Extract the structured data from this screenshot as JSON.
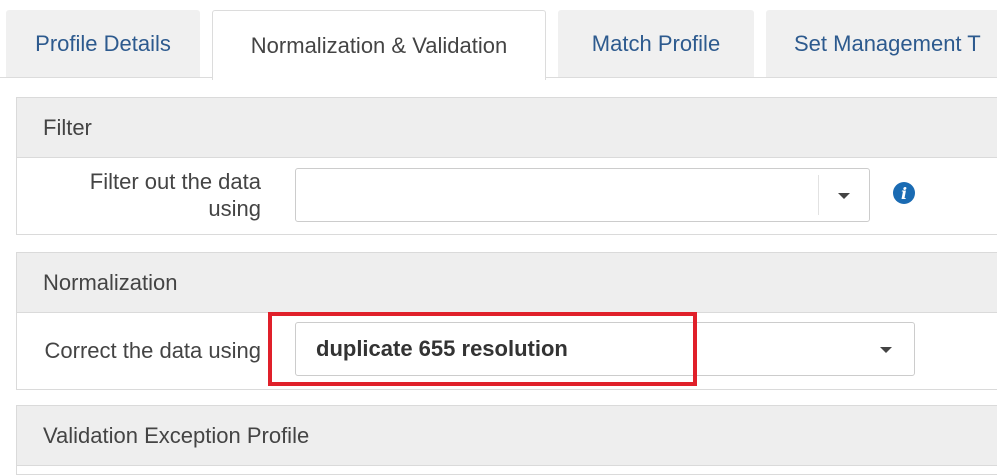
{
  "tabs": [
    {
      "label": "Profile Details",
      "active": false
    },
    {
      "label": "Normalization & Validation",
      "active": true
    },
    {
      "label": "Match Profile",
      "active": false
    },
    {
      "label": "Set Management T",
      "active": false
    }
  ],
  "filter": {
    "title": "Filter",
    "field_label_line1": "Filter out the data",
    "field_label_line2": "using",
    "select_value": ""
  },
  "normalization": {
    "title": "Normalization",
    "field_label": "Correct the data using",
    "select_value": "duplicate 655 resolution"
  },
  "validation": {
    "title": "Validation Exception Profile"
  },
  "colors": {
    "tab_text": "#2d5a8e",
    "info_icon": "#1a6bb3",
    "highlight": "#e0202a"
  }
}
